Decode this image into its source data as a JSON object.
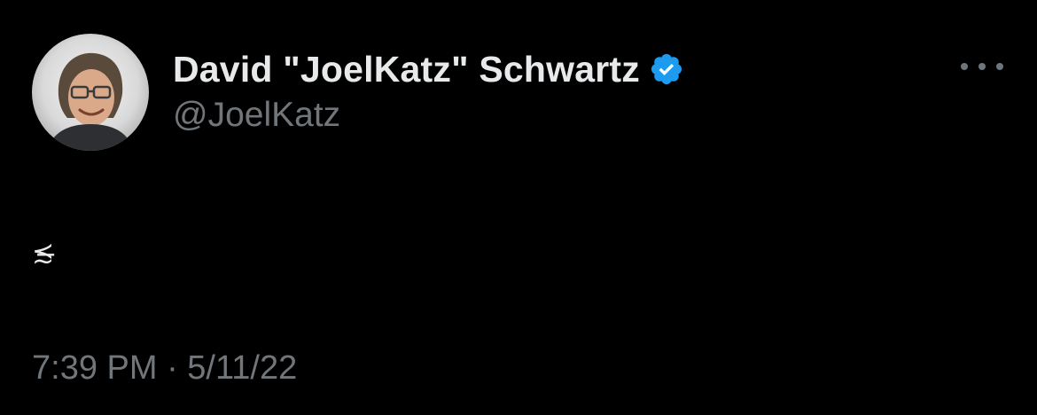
{
  "tweet": {
    "display_name": "David \"JoelKatz\" Schwartz",
    "handle": "@JoelKatz",
    "verified": true,
    "verified_icon": "verified-badge-icon",
    "more_icon": "more-options-icon",
    "text": "≾̶",
    "timestamp": "7:39 PM · 5/11/22"
  },
  "colors": {
    "background": "#000000",
    "primary_text": "#e7e9ea",
    "secondary_text": "#71767b",
    "verified_blue": "#1d9bf0"
  }
}
